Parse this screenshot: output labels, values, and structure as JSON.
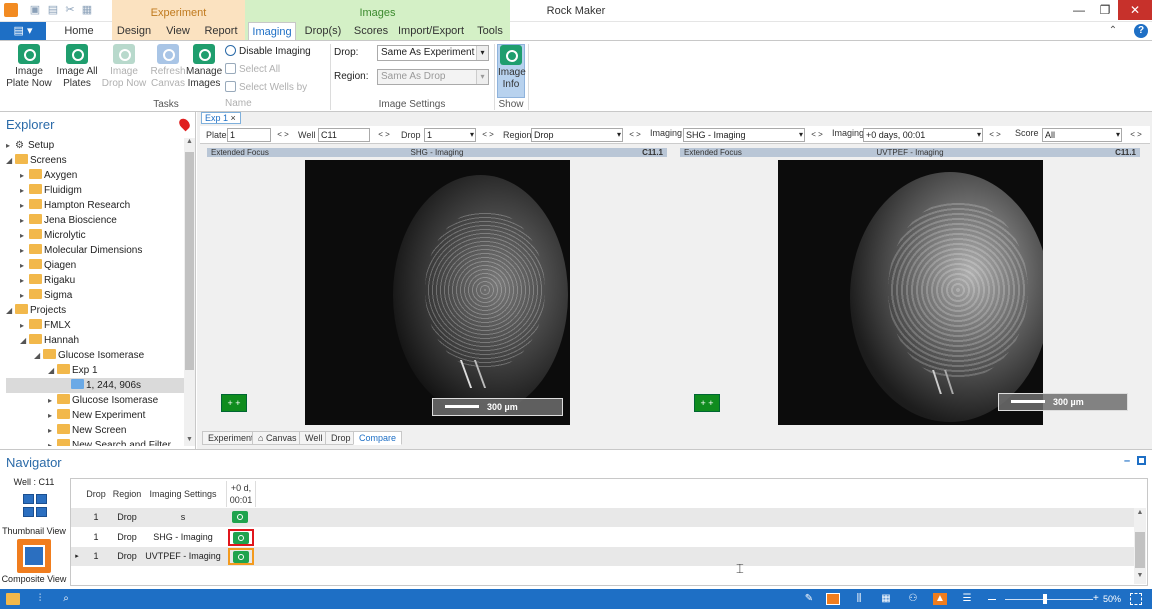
{
  "window": {
    "title": "Rock Maker"
  },
  "contextual": {
    "experiment": "Experiment",
    "images": "Images"
  },
  "tabs": [
    "Home",
    "Design",
    "View",
    "Report",
    "Imaging",
    "Drop(s)",
    "Scores",
    "Import/Export",
    "Tools"
  ],
  "ribbon": {
    "tasks": {
      "label": "Tasks",
      "image_plate_now": "Image Plate Now",
      "image_all_plates": "Image All Plates",
      "image_drop_now": "Image Drop Now",
      "refresh_canvas": "Refresh Canvas",
      "manage_images": "Manage Images",
      "disable_imaging": "Disable Imaging",
      "select_all": "Select All",
      "select_wells_by_name": "Select Wells by Name"
    },
    "image_settings": {
      "label": "Image Settings",
      "drop_label": "Drop:",
      "drop_value": "Same As Experiment",
      "region_label": "Region:",
      "region_value": "Same As Drop"
    },
    "show": {
      "label": "Show",
      "image_info": "Image Info"
    }
  },
  "explorer": {
    "title": "Explorer",
    "items": [
      {
        "label": "Setup",
        "level": 0,
        "type": "gear",
        "tw": "▸"
      },
      {
        "label": "Screens",
        "level": 0,
        "type": "folder",
        "tw": "◢"
      },
      {
        "label": "Axygen",
        "level": 1,
        "type": "folder",
        "tw": "▸"
      },
      {
        "label": "Fluidigm",
        "level": 1,
        "type": "folder",
        "tw": "▸"
      },
      {
        "label": "Hampton Research",
        "level": 1,
        "type": "folder",
        "tw": "▸"
      },
      {
        "label": "Jena Bioscience",
        "level": 1,
        "type": "folder",
        "tw": "▸"
      },
      {
        "label": "Microlytic",
        "level": 1,
        "type": "folder",
        "tw": "▸"
      },
      {
        "label": "Molecular Dimensions",
        "level": 1,
        "type": "folder",
        "tw": "▸"
      },
      {
        "label": "Qiagen",
        "level": 1,
        "type": "folder",
        "tw": "▸"
      },
      {
        "label": "Rigaku",
        "level": 1,
        "type": "folder",
        "tw": "▸"
      },
      {
        "label": "Sigma",
        "level": 1,
        "type": "folder",
        "tw": "▸"
      },
      {
        "label": "Projects",
        "level": 0,
        "type": "folder",
        "tw": "◢"
      },
      {
        "label": "FMLX",
        "level": 1,
        "type": "folder",
        "tw": "▸"
      },
      {
        "label": "Hannah",
        "level": 1,
        "type": "folder",
        "tw": "◢"
      },
      {
        "label": "Glucose Isomerase",
        "level": 2,
        "type": "folder",
        "tw": "◢"
      },
      {
        "label": "Exp 1",
        "level": 3,
        "type": "folder",
        "tw": "◢"
      },
      {
        "label": "1, 244, 906s",
        "level": 4,
        "type": "plate",
        "tw": ""
      },
      {
        "label": "Glucose Isomerase",
        "level": 3,
        "type": "folder",
        "tw": "▸"
      },
      {
        "label": "New Experiment",
        "level": 3,
        "type": "folder",
        "tw": "▸"
      },
      {
        "label": "New Screen",
        "level": 3,
        "type": "folder",
        "tw": "▸"
      },
      {
        "label": "New Search and Filter",
        "level": 3,
        "type": "folder",
        "tw": "▸"
      }
    ]
  },
  "document": {
    "tab_label": "Exp 1",
    "plate_label": "Plate",
    "plate_value": "1",
    "well_label": "Well",
    "well_value": "C11",
    "drop_label": "Drop",
    "drop_value": "1",
    "region_label": "Region",
    "region_value": "Drop",
    "imaging_label": "Imaging",
    "imaging_value": "SHG - Imaging",
    "imaging2_label": "Imaging",
    "imaging2_value": "+0 days, 00:01",
    "score_label": "Score",
    "score_value": "All",
    "nav_arrows": "< >",
    "left_panel": {
      "mode": "Extended Focus",
      "setting": "SHG - Imaging",
      "well": "C11.1",
      "scale": "300 µm"
    },
    "right_panel": {
      "mode": "Extended Focus",
      "setting": "UVTPEF - Imaging",
      "well": "C11.1",
      "scale": "300 µm"
    },
    "bottom_tabs": [
      "Experiment",
      "Canvas",
      "Well",
      "Drop",
      "Compare"
    ]
  },
  "navigator": {
    "title": "Navigator",
    "well_label": "Well : C11",
    "thumbnail_view": "Thumbnail View",
    "composite_view": "Composite View",
    "headers": {
      "drop": "Drop",
      "region": "Region",
      "imaging_settings": "Imaging Settings",
      "time": "+0 d, 00:01"
    },
    "rows": [
      {
        "drop": "1",
        "region": "Drop",
        "imaging": "s"
      },
      {
        "drop": "1",
        "region": "Drop",
        "imaging": "SHG - Imaging"
      },
      {
        "drop": "1",
        "region": "Drop",
        "imaging": "UVTPEF - Imaging"
      }
    ]
  },
  "status": {
    "zoom": "50%"
  },
  "colors": {
    "accent": "#1e6fc5",
    "experiment_ctx": "#fbe2c0",
    "images_ctx": "#d4f0c6",
    "highlight_red": "#e0161c",
    "highlight_orange": "#f39a1e"
  }
}
